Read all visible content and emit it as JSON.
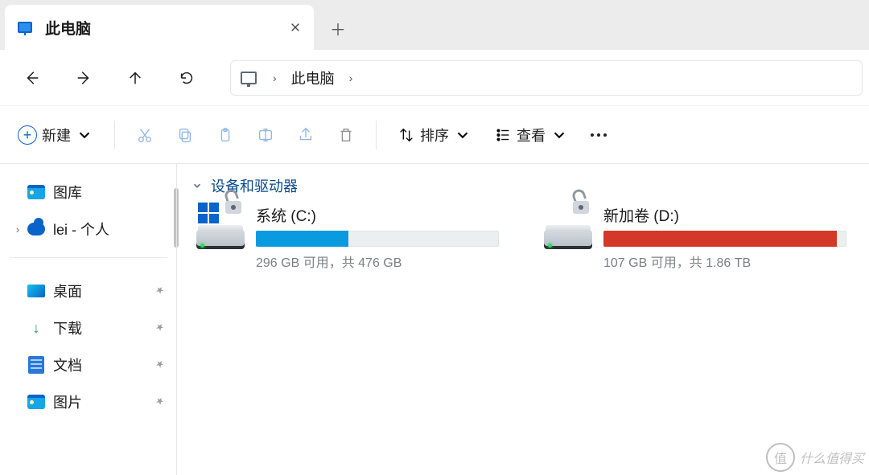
{
  "tab": {
    "title": "此电脑"
  },
  "breadcrumb": {
    "current": "此电脑"
  },
  "toolbar": {
    "new_label": "新建",
    "sort_label": "排序",
    "view_label": "查看"
  },
  "sidebar": {
    "items": [
      {
        "label": "图库",
        "icon": "gallery",
        "pinned": false,
        "expandable": false
      },
      {
        "label": "lei - 个人",
        "icon": "onedrive",
        "pinned": false,
        "expandable": true
      },
      {
        "label": "桌面",
        "icon": "desktop",
        "pinned": true,
        "expandable": false
      },
      {
        "label": "下载",
        "icon": "download",
        "pinned": true,
        "expandable": false
      },
      {
        "label": "文档",
        "icon": "document",
        "pinned": true,
        "expandable": false
      },
      {
        "label": "图片",
        "icon": "picture",
        "pinned": true,
        "expandable": false
      }
    ]
  },
  "section": {
    "title": "设备和驱动器"
  },
  "drives": [
    {
      "name": "系统 (C:)",
      "free": "296 GB",
      "total": "476 GB",
      "stat": "296 GB 可用，共 476 GB",
      "fill_percent": 38,
      "color": "#0a9ae0",
      "system": true
    },
    {
      "name": "新加卷 (D:)",
      "free": "107 GB",
      "total": "1.86 TB",
      "stat": "107 GB 可用，共 1.86 TB",
      "fill_percent": 96,
      "color": "#d33828",
      "system": false
    }
  ],
  "watermark": {
    "badge": "值",
    "text": "什么值得买"
  }
}
